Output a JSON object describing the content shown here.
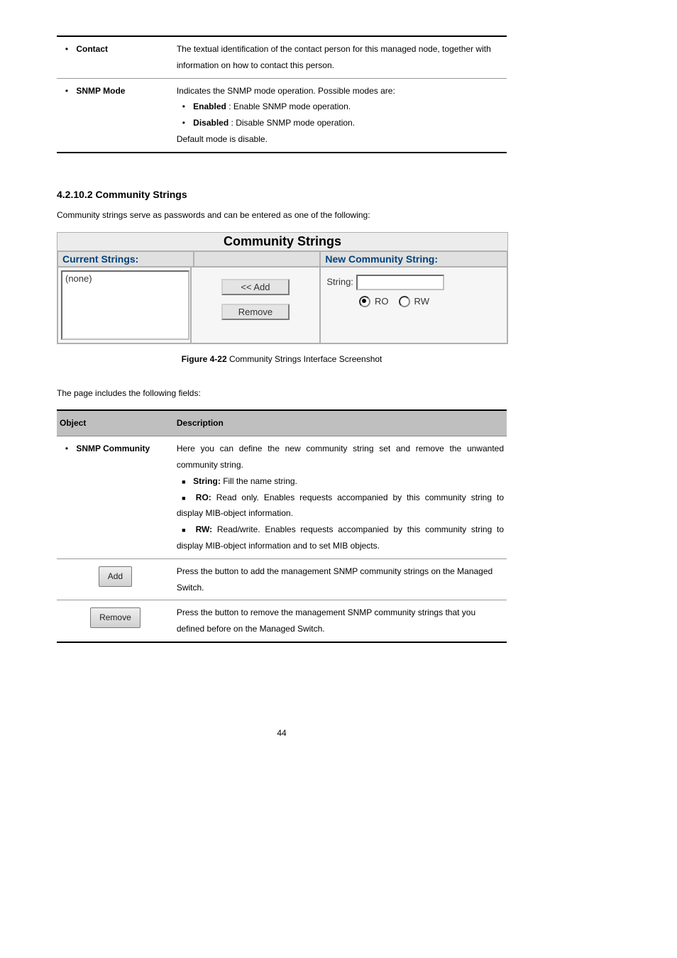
{
  "top_table": {
    "row1": {
      "label": "Contact",
      "desc": "The textual identification of the contact person for this managed node, together with information on how to contact this person."
    },
    "row2": {
      "label": "SNMP Mode",
      "desc_intro": "Indicates the SNMP mode operation. Possible modes are:",
      "opt1_key": "Enabled",
      "opt1_val": ": Enable SNMP mode operation.",
      "opt2_key": "Disabled",
      "opt2_val": ": Disable SNMP mode operation.",
      "default": "Default mode is disable."
    }
  },
  "section_heading": "4.2.10.2 Community Strings",
  "intro": "Community strings serve as passwords and can be entered as one of the following:",
  "screenshot": {
    "title": "Community Strings",
    "left_header": "Current Strings:",
    "right_header": "New Community String:",
    "list_value": "(none)",
    "btn_add": "<< Add",
    "btn_remove": "Remove",
    "string_label": "String:",
    "ro": "RO",
    "rw": "RW"
  },
  "figure_label": "Figure 4-22",
  "figure_caption": "Community Strings Interface Screenshot",
  "fields_intro": "The page includes the following fields:",
  "fields_table": {
    "hdr_obj": "Object",
    "hdr_desc": "Description",
    "r1_label": "SNMP Community",
    "r1_desc": "Here you can define the new community string set and remove the unwanted community string.",
    "r1_b1_key": "String:",
    "r1_b1_val": "Fill the name string.",
    "r1_b2_key": "RO:",
    "r1_b2_val": "Read only. Enables requests accompanied by this community string to display MIB-object information.",
    "r1_b3_key": "RW:",
    "r1_b3_val": "Read/write. Enables requests accompanied by this community string to display MIB-object information and to set MIB objects.",
    "add_btn": "Add",
    "add_desc": "Press the button to add the management SNMP community strings on the Managed Switch.",
    "remove_btn": "Remove",
    "remove_desc": "Press the button to remove the management SNMP community strings that you defined before on the Managed Switch."
  },
  "page_number": "44"
}
